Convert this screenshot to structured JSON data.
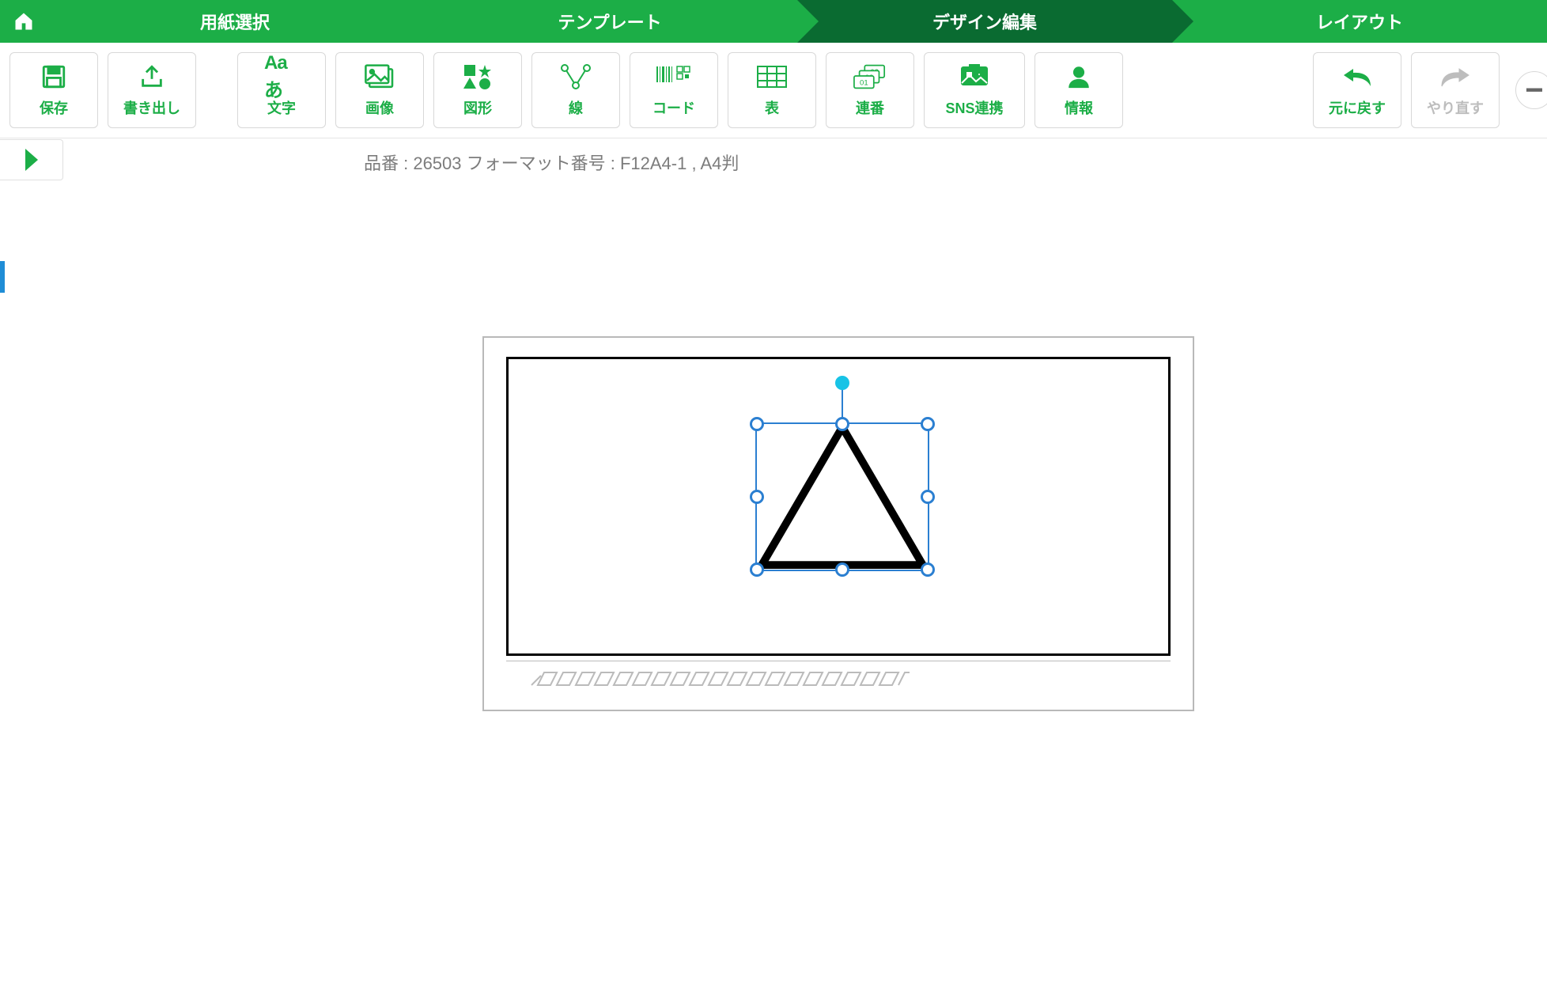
{
  "colors": {
    "primary_green": "#1cae47",
    "active_green": "#0a6b31",
    "selection_blue": "#2b7fd1",
    "rotation_handle": "#17c3e6",
    "disabled_gray": "#bdbdbd"
  },
  "stepper": {
    "steps": [
      {
        "id": "paper",
        "label": "用紙選択",
        "active": false
      },
      {
        "id": "template",
        "label": "テンプレート",
        "active": false
      },
      {
        "id": "design",
        "label": "デザイン編集",
        "active": true
      },
      {
        "id": "layout",
        "label": "レイアウト",
        "active": false
      }
    ]
  },
  "toolbar": {
    "save": {
      "label": "保存",
      "icon": "save-icon"
    },
    "export": {
      "label": "書き出し",
      "icon": "export-icon"
    },
    "text": {
      "label": "文字",
      "icon": "text-icon"
    },
    "image": {
      "label": "画像",
      "icon": "image-icon"
    },
    "shape": {
      "label": "図形",
      "icon": "shapes-icon"
    },
    "line": {
      "label": "線",
      "icon": "polyline-icon"
    },
    "code": {
      "label": "コード",
      "icon": "barcode-icon"
    },
    "table": {
      "label": "表",
      "icon": "table-icon"
    },
    "serial": {
      "label": "連番",
      "icon": "serial-icon"
    },
    "sns": {
      "label": "SNS連携",
      "icon": "sns-icon"
    },
    "info": {
      "label": "情報",
      "icon": "person-icon"
    },
    "undo": {
      "label": "元に戻す",
      "icon": "undo-icon",
      "enabled": true
    },
    "redo": {
      "label": "やり直す",
      "icon": "redo-icon",
      "enabled": false
    }
  },
  "doc_info": "品番 : 26503 フォーマット番号 : F12A4-1 , A4判",
  "canvas": {
    "selected_shape": {
      "type": "triangle",
      "stroke": "#000",
      "stroke_width": 8
    }
  }
}
